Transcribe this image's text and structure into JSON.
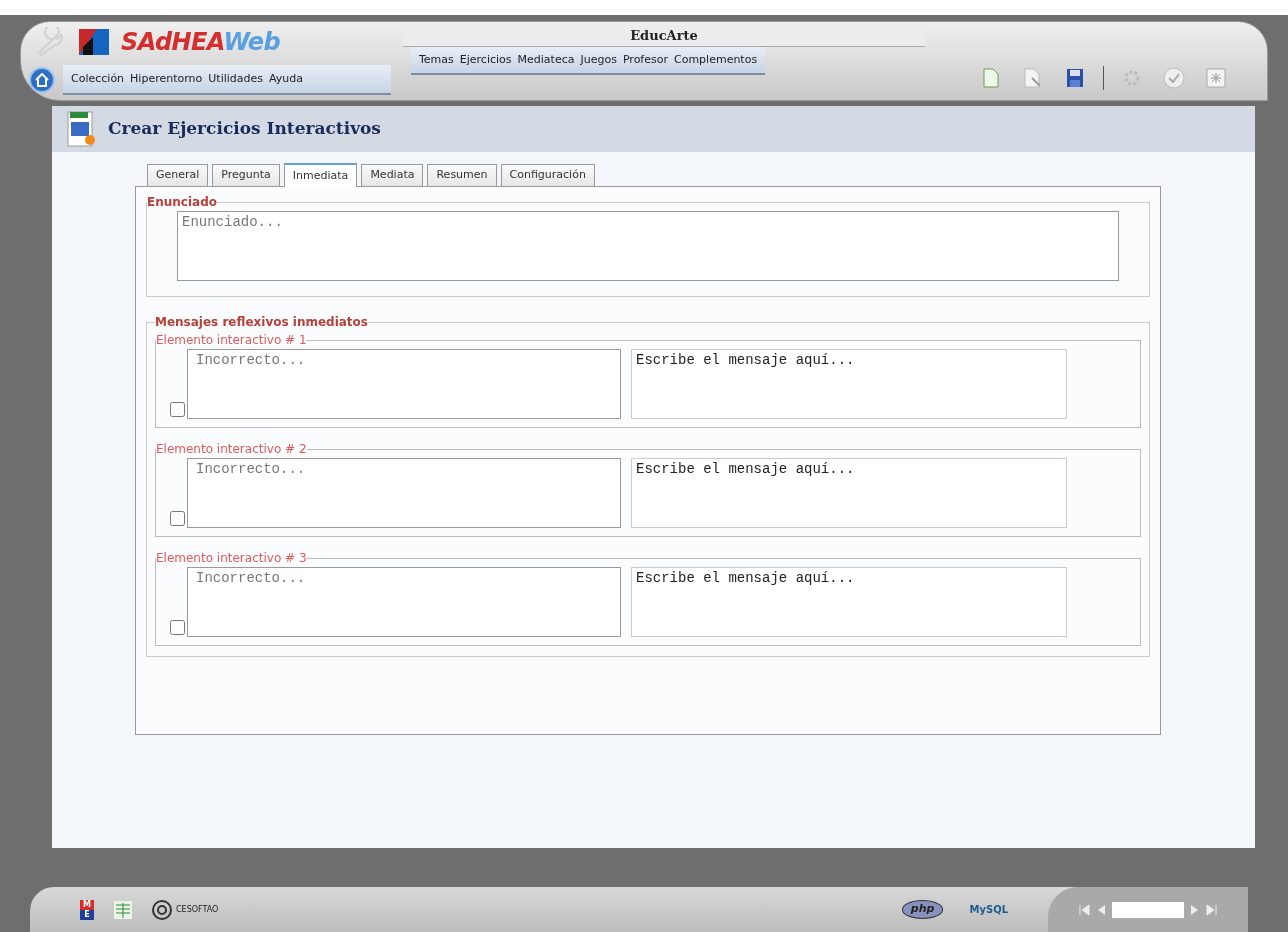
{
  "header": {
    "logo": {
      "part1": "SAdHEA",
      "part2": "Web"
    },
    "title": "EducArte",
    "left_menu": [
      "Colección",
      "Hiperentorno",
      "Utilidades",
      "Ayuda"
    ],
    "center_menu": [
      "Temas",
      "Ejercicios",
      "Mediateca",
      "Juegos",
      "Profesor",
      "Complementos"
    ]
  },
  "page": {
    "title": "Crear Ejercicios Interactivos",
    "tabs": [
      {
        "label": "General",
        "selected": false
      },
      {
        "label": "Pregunta",
        "selected": false
      },
      {
        "label": "Inmediata",
        "selected": true
      },
      {
        "label": "Mediata",
        "selected": false
      },
      {
        "label": "Resumen",
        "selected": false
      },
      {
        "label": "Configuración",
        "selected": false
      }
    ],
    "statement": {
      "legend": "Enunciado",
      "placeholder": "Enunciado..."
    },
    "messages": {
      "legend": "Mensajes reflexivos inmediatos",
      "elements": [
        {
          "legend": "Elemento interactivo # 1",
          "checked": false,
          "answer_placeholder": "Incorrecto...",
          "message_placeholder": "Escribe el mensaje aquí..."
        },
        {
          "legend": "Elemento interactivo # 2",
          "checked": false,
          "answer_placeholder": "Incorrecto...",
          "message_placeholder": "Escribe el mensaje aquí..."
        },
        {
          "legend": "Elemento interactivo # 3",
          "checked": false,
          "answer_placeholder": "Incorrecto...",
          "message_placeholder": "Escribe el mensaje aquí..."
        }
      ]
    }
  },
  "footer": {
    "me_logo": [
      "M",
      "E"
    ],
    "cesoftao": "CESOFTAO",
    "php": "php",
    "mysql": "MySQL"
  }
}
